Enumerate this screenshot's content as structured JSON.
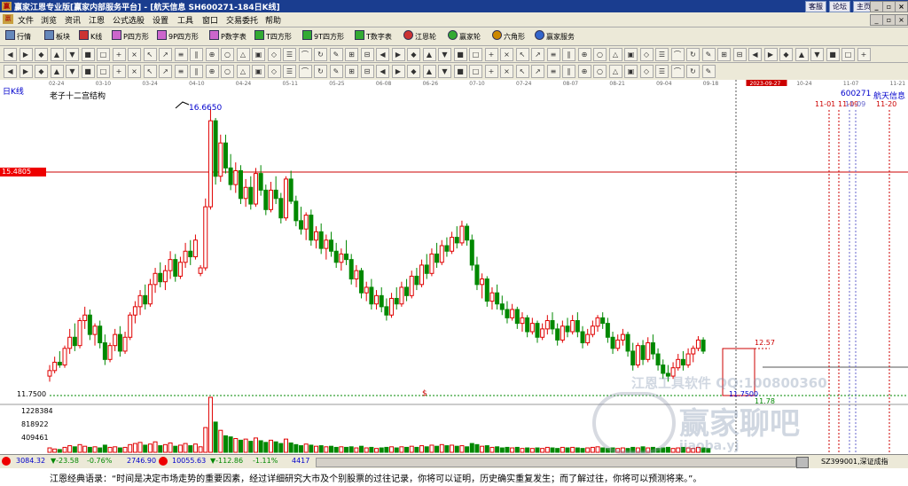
{
  "window": {
    "title": "赢家江恩专业版[赢家内部服务平台] - [航天信息  SH600271-184日K线]",
    "logo_glyph": "赢",
    "top_links": [
      "客服",
      "论坛",
      "主页"
    ],
    "controls": [
      "_",
      "▫",
      "×"
    ],
    "mdi_controls": [
      "_",
      "▫",
      "×"
    ]
  },
  "menu": {
    "items": [
      "文件",
      "浏览",
      "资讯",
      "江恩",
      "公式选股",
      "设置",
      "工具",
      "窗口",
      "交易委托",
      "帮助"
    ]
  },
  "toolbar1": {
    "items": [
      "行情",
      "板块",
      "K线",
      "P四方形",
      "9P四方形",
      "P数字表",
      "T四方形",
      "9T四方形",
      "T数字表",
      "江恩轮",
      "赢家轮",
      "六角形",
      "赢家服务"
    ]
  },
  "chart": {
    "period_label": "日K线",
    "indicator_label": "老子十二宫结构",
    "stock_code": "600271",
    "stock_name": "航天信息",
    "date_axis": [
      "02-24",
      "03-10",
      "03-24",
      "04-10",
      "04-24",
      "05-11",
      "05-25",
      "06-08",
      "06-26",
      "07-10",
      "07-24",
      "08-07",
      "08-21",
      "09-04",
      "09-18",
      "2023-09-27",
      "10-24",
      "11-07",
      "11-21"
    ],
    "cursor_price_label": "15.4805",
    "high_label": "16.6650",
    "low_label": "11.7500",
    "low_label_2": "11.7500",
    "recent_high": "12.57",
    "recent_low": "11.78",
    "future_dates": [
      "11-01",
      "11-09",
      "11-20"
    ],
    "future_date_mid_ghost": "11-09",
    "watermark_text": "江恩工具软件 QQ:100800360",
    "watermark_logo_text": "赢家聊吧",
    "watermark_url": "jiaoba.yj"
  },
  "chart_data": {
    "type": "candlestick",
    "title": "老子十二宫结构",
    "price_axis_labels": [
      "15.4805",
      "11.7500"
    ],
    "volume_axis_labels": [
      "1228384",
      "818922",
      "409461"
    ],
    "ohlc": [
      [
        11.85,
        12.05,
        11.75,
        11.95
      ],
      [
        11.95,
        12.2,
        11.9,
        12.1
      ],
      [
        12.1,
        12.3,
        12.0,
        12.05
      ],
      [
        12.05,
        12.4,
        12.0,
        12.35
      ],
      [
        12.35,
        12.7,
        12.25,
        12.55
      ],
      [
        12.55,
        12.8,
        12.3,
        12.4
      ],
      [
        12.4,
        12.9,
        12.35,
        12.85
      ],
      [
        12.85,
        13.1,
        12.7,
        12.95
      ],
      [
        12.95,
        13.05,
        12.5,
        12.6
      ],
      [
        12.6,
        12.8,
        12.4,
        12.75
      ],
      [
        12.75,
        12.85,
        12.35,
        12.45
      ],
      [
        12.45,
        12.6,
        12.05,
        12.15
      ],
      [
        12.15,
        12.45,
        12.1,
        12.4
      ],
      [
        12.4,
        12.7,
        12.3,
        12.6
      ],
      [
        12.6,
        12.75,
        12.2,
        12.3
      ],
      [
        12.3,
        12.65,
        12.25,
        12.55
      ],
      [
        12.55,
        13.0,
        12.5,
        12.95
      ],
      [
        12.95,
        13.2,
        12.8,
        13.1
      ],
      [
        13.1,
        13.4,
        12.95,
        13.3
      ],
      [
        13.3,
        13.5,
        13.05,
        13.15
      ],
      [
        13.15,
        13.6,
        13.1,
        13.5
      ],
      [
        13.5,
        13.8,
        13.35,
        13.7
      ],
      [
        13.7,
        13.9,
        13.45,
        13.55
      ],
      [
        13.55,
        13.85,
        13.4,
        13.75
      ],
      [
        13.75,
        14.1,
        13.6,
        13.95
      ],
      [
        13.95,
        14.05,
        13.55,
        13.65
      ],
      [
        13.65,
        14.0,
        13.6,
        13.9
      ],
      [
        13.9,
        14.25,
        13.8,
        14.1
      ],
      [
        14.1,
        14.3,
        13.85,
        14.0
      ],
      [
        14.0,
        14.4,
        13.95,
        14.3
      ],
      [
        13.7,
        13.85,
        13.65,
        13.8
      ],
      [
        13.8,
        15.05,
        13.75,
        14.9
      ],
      [
        14.9,
        16.66,
        14.85,
        16.45
      ],
      [
        16.45,
        16.5,
        15.3,
        15.45
      ],
      [
        15.45,
        16.2,
        15.35,
        16.05
      ],
      [
        16.05,
        16.2,
        15.5,
        15.6
      ],
      [
        15.6,
        15.85,
        15.2,
        15.3
      ],
      [
        15.3,
        15.7,
        15.15,
        15.55
      ],
      [
        15.55,
        15.65,
        14.95,
        15.05
      ],
      [
        15.05,
        15.4,
        14.9,
        15.25
      ],
      [
        15.25,
        15.45,
        14.85,
        14.95
      ],
      [
        14.95,
        15.6,
        14.9,
        15.5
      ],
      [
        15.5,
        15.65,
        15.1,
        15.2
      ],
      [
        15.2,
        15.3,
        14.75,
        14.85
      ],
      [
        14.85,
        15.35,
        14.8,
        15.2
      ],
      [
        15.2,
        15.45,
        14.95,
        15.05
      ],
      [
        15.05,
        15.15,
        14.6,
        14.7
      ],
      [
        14.7,
        15.45,
        14.65,
        15.4
      ],
      [
        15.4,
        15.55,
        14.95,
        15.0
      ],
      [
        15.0,
        15.1,
        14.55,
        14.65
      ],
      [
        14.65,
        14.9,
        14.4,
        14.5
      ],
      [
        14.5,
        14.8,
        14.3,
        14.75
      ],
      [
        14.75,
        14.85,
        14.2,
        14.3
      ],
      [
        14.3,
        14.55,
        14.15,
        14.45
      ],
      [
        14.45,
        14.6,
        14.05,
        14.15
      ],
      [
        14.15,
        14.4,
        13.95,
        14.3
      ],
      [
        14.3,
        14.45,
        14.0,
        14.1
      ],
      [
        14.1,
        14.25,
        13.8,
        13.9
      ],
      [
        13.9,
        14.15,
        13.75,
        14.05
      ],
      [
        14.05,
        14.3,
        13.85,
        13.95
      ],
      [
        13.95,
        14.05,
        13.5,
        13.6
      ],
      [
        13.6,
        13.85,
        13.45,
        13.75
      ],
      [
        13.75,
        13.8,
        13.25,
        13.35
      ],
      [
        13.35,
        13.55,
        13.2,
        13.45
      ],
      [
        13.45,
        13.6,
        13.05,
        13.15
      ],
      [
        13.15,
        13.4,
        13.05,
        13.3
      ],
      [
        13.3,
        13.45,
        13.0,
        13.1
      ],
      [
        13.1,
        13.25,
        12.85,
        12.95
      ],
      [
        12.95,
        13.35,
        12.9,
        13.25
      ],
      [
        13.25,
        13.45,
        13.05,
        13.15
      ],
      [
        13.15,
        13.55,
        13.1,
        13.45
      ],
      [
        13.45,
        13.6,
        13.2,
        13.3
      ],
      [
        13.3,
        13.75,
        13.25,
        13.65
      ],
      [
        13.65,
        13.8,
        13.4,
        13.5
      ],
      [
        13.5,
        13.95,
        13.45,
        13.85
      ],
      [
        13.85,
        14.05,
        13.6,
        13.7
      ],
      [
        13.7,
        14.15,
        13.65,
        14.05
      ],
      [
        14.05,
        14.25,
        13.8,
        13.9
      ],
      [
        13.9,
        14.3,
        13.85,
        14.2
      ],
      [
        14.2,
        14.35,
        14.0,
        14.1
      ],
      [
        14.1,
        14.45,
        14.05,
        14.35
      ],
      [
        14.35,
        14.55,
        14.15,
        14.25
      ],
      [
        14.25,
        14.65,
        14.2,
        14.55
      ],
      [
        14.55,
        14.6,
        14.2,
        14.3
      ],
      [
        14.3,
        14.4,
        13.75,
        13.85
      ],
      [
        13.85,
        14.0,
        13.4,
        13.5
      ],
      [
        13.5,
        13.7,
        13.25,
        13.6
      ],
      [
        13.6,
        13.65,
        13.1,
        13.2
      ],
      [
        13.2,
        13.45,
        13.05,
        13.35
      ],
      [
        13.35,
        13.5,
        13.05,
        13.15
      ],
      [
        13.15,
        13.3,
        12.95,
        13.05
      ],
      [
        13.05,
        13.2,
        12.8,
        12.9
      ],
      [
        12.9,
        13.15,
        12.85,
        13.05
      ],
      [
        13.05,
        13.1,
        12.7,
        12.8
      ],
      [
        12.8,
        13.0,
        12.65,
        12.9
      ],
      [
        12.9,
        12.95,
        12.55,
        12.65
      ],
      [
        12.65,
        12.9,
        12.6,
        12.8
      ],
      [
        12.8,
        12.85,
        12.45,
        12.55
      ],
      [
        12.55,
        12.8,
        12.5,
        12.7
      ],
      [
        12.7,
        12.95,
        12.6,
        12.85
      ],
      [
        12.85,
        13.0,
        12.6,
        12.7
      ],
      [
        12.7,
        12.8,
        12.4,
        12.5
      ],
      [
        12.5,
        12.85,
        12.45,
        12.75
      ],
      [
        12.75,
        12.9,
        12.55,
        12.65
      ],
      [
        12.65,
        12.95,
        12.6,
        12.85
      ],
      [
        12.85,
        13.0,
        12.55,
        12.65
      ],
      [
        12.65,
        12.75,
        12.35,
        12.45
      ],
      [
        12.45,
        12.7,
        12.4,
        12.6
      ],
      [
        12.6,
        12.85,
        12.55,
        12.75
      ],
      [
        12.75,
        12.95,
        12.65,
        12.9
      ],
      [
        12.9,
        13.0,
        12.7,
        12.8
      ],
      [
        12.8,
        12.9,
        12.45,
        12.55
      ],
      [
        12.55,
        12.65,
        12.25,
        12.35
      ],
      [
        12.35,
        12.6,
        12.3,
        12.5
      ],
      [
        12.5,
        12.7,
        12.4,
        12.6
      ],
      [
        12.6,
        12.65,
        12.2,
        12.3
      ],
      [
        12.3,
        12.45,
        11.95,
        12.05
      ],
      [
        12.05,
        12.45,
        12.0,
        12.4
      ],
      [
        12.4,
        12.5,
        12.05,
        12.15
      ],
      [
        12.15,
        12.55,
        12.1,
        12.45
      ],
      [
        12.45,
        12.6,
        12.15,
        12.25
      ],
      [
        12.25,
        12.35,
        11.95,
        12.05
      ],
      [
        12.05,
        12.15,
        11.8,
        11.9
      ],
      [
        11.9,
        12.05,
        11.75,
        11.85
      ],
      [
        11.85,
        12.1,
        11.8,
        12.0
      ],
      [
        12.0,
        12.25,
        11.95,
        12.15
      ],
      [
        12.15,
        12.3,
        11.95,
        12.05
      ],
      [
        12.05,
        12.35,
        12.0,
        12.25
      ],
      [
        12.25,
        12.4,
        12.1,
        12.35
      ],
      [
        12.35,
        12.57,
        12.3,
        12.5
      ],
      [
        12.5,
        12.55,
        12.25,
        12.3
      ]
    ],
    "volume": [
      0.08,
      0.06,
      0.05,
      0.09,
      0.12,
      0.1,
      0.14,
      0.11,
      0.09,
      0.1,
      0.08,
      0.13,
      0.09,
      0.1,
      0.08,
      0.09,
      0.14,
      0.16,
      0.18,
      0.13,
      0.15,
      0.19,
      0.12,
      0.14,
      0.17,
      0.11,
      0.13,
      0.16,
      0.12,
      0.15,
      0.1,
      0.45,
      1.0,
      0.55,
      0.4,
      0.3,
      0.28,
      0.25,
      0.22,
      0.24,
      0.2,
      0.26,
      0.21,
      0.18,
      0.22,
      0.19,
      0.16,
      0.24,
      0.17,
      0.14,
      0.12,
      0.15,
      0.13,
      0.11,
      0.12,
      0.1,
      0.11,
      0.09,
      0.1,
      0.09,
      0.1,
      0.08,
      0.11,
      0.08,
      0.09,
      0.07,
      0.08,
      0.09,
      0.1,
      0.08,
      0.1,
      0.09,
      0.11,
      0.09,
      0.12,
      0.1,
      0.13,
      0.11,
      0.14,
      0.12,
      0.13,
      0.11,
      0.12,
      0.1,
      0.16,
      0.14,
      0.11,
      0.12,
      0.09,
      0.1,
      0.08,
      0.09,
      0.08,
      0.09,
      0.07,
      0.08,
      0.07,
      0.08,
      0.07,
      0.09,
      0.08,
      0.07,
      0.09,
      0.08,
      0.09,
      0.08,
      0.07,
      0.08,
      0.09,
      0.1,
      0.08,
      0.07,
      0.08,
      0.07,
      0.08,
      0.07,
      0.09,
      0.08,
      0.1,
      0.08,
      0.09,
      0.07,
      0.08,
      0.09,
      0.07,
      0.08,
      0.09,
      0.08,
      0.07,
      0.09,
      0.08,
      0.07
    ],
    "ylim": [
      11.5,
      16.9
    ]
  },
  "statusbar": {
    "sh_index": "3084.32",
    "sh_change": "▼-23.58",
    "sh_pct": "-0.76%",
    "sh_amount": "2746.90",
    "sz_index": "10055.63",
    "sz_change": "▼-112.86",
    "sz_pct": "-1.11%",
    "sz_amount": "4417",
    "right_label": "SZ399001,深证成指"
  },
  "quote": {
    "text": "江恩经典语录：“时间是决定市场走势的重要因素，经过详细研究大市及个别股票的过往记录，你将可以证明，历史确实重复发生；而了解过往，你将可以预测将来。”。"
  },
  "colors": {
    "up": "#e00000",
    "down": "#008800",
    "titlebar": "#1a3d8f",
    "panel": "#ece9d8"
  }
}
